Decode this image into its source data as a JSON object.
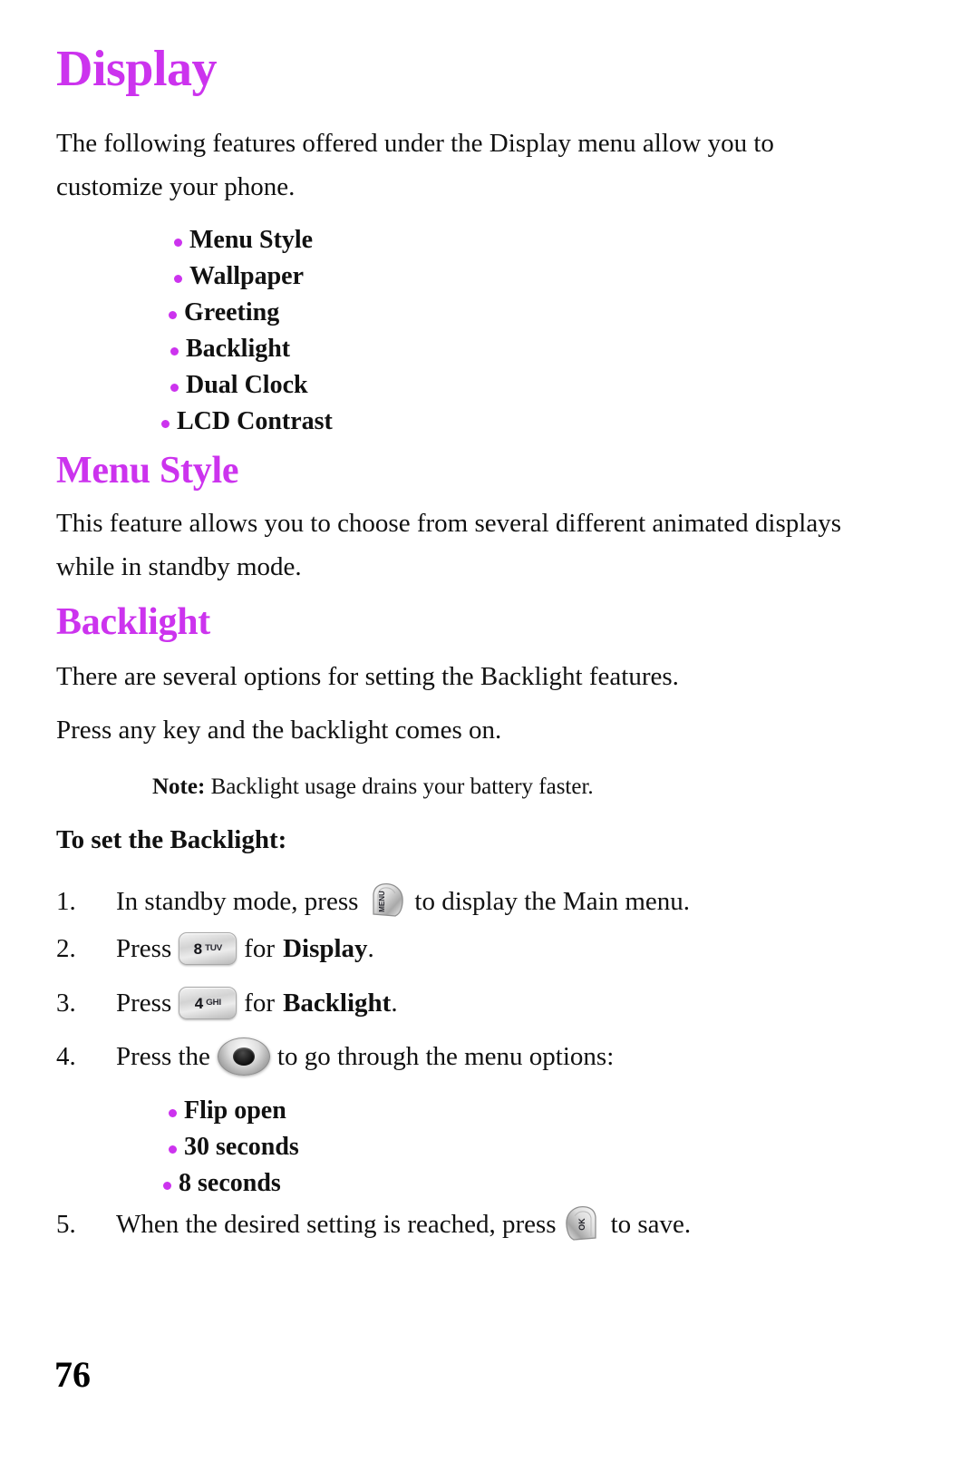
{
  "page": {
    "number": "76",
    "accent_color": "#cc33ee",
    "text_color": "#111111",
    "background": "#ffffff"
  },
  "title": "Display",
  "intro_paragraph": "The following features offered under the Display menu allow you to customize your phone.",
  "feature_list": [
    "Menu Style",
    "Wallpaper",
    "Greeting",
    "Backlight",
    "Dual Clock",
    "LCD Contrast"
  ],
  "sections": {
    "menu_style": {
      "heading": "Menu Style",
      "body": "This feature allows you to choose from several different animated displays while in standby mode."
    },
    "backlight": {
      "heading": "Backlight",
      "body1": "There are several options for setting the Backlight features.",
      "body2": "Press any key and the backlight comes on.",
      "note_label": "Note:",
      "note_text": "Backlight usage drains your battery faster.",
      "procedure_heading": "To set the Backlight:",
      "steps": [
        {
          "number": "1.",
          "before": "In standby mode, press",
          "icon": "menu-key-icon",
          "icon_label": "MENU",
          "after": "to display the Main menu.",
          "after_bold": "",
          "after_tail": ""
        },
        {
          "number": "2.",
          "before": "Press",
          "icon": "keypad-key-8-icon",
          "icon_digit": "8",
          "icon_letters": "TUV",
          "after": "for",
          "after_bold": "Display",
          "after_tail": "."
        },
        {
          "number": "3.",
          "before": "Press",
          "icon": "keypad-key-4-icon",
          "icon_digit": "4",
          "icon_letters": "GHI",
          "after": "for",
          "after_bold": "Backlight",
          "after_tail": "."
        },
        {
          "number": "4.",
          "before": "Press the",
          "icon": "navigation-key-icon",
          "after": "to go through the menu options:",
          "after_bold": "",
          "after_tail": ""
        },
        {
          "number": "5.",
          "before": "When the desired setting is reached, press",
          "icon": "ok-key-icon",
          "icon_label": "OK",
          "after": "to save.",
          "after_bold": "",
          "after_tail": ""
        }
      ],
      "backlight_options": [
        "Flip open",
        "30 seconds",
        "8 seconds"
      ]
    }
  }
}
